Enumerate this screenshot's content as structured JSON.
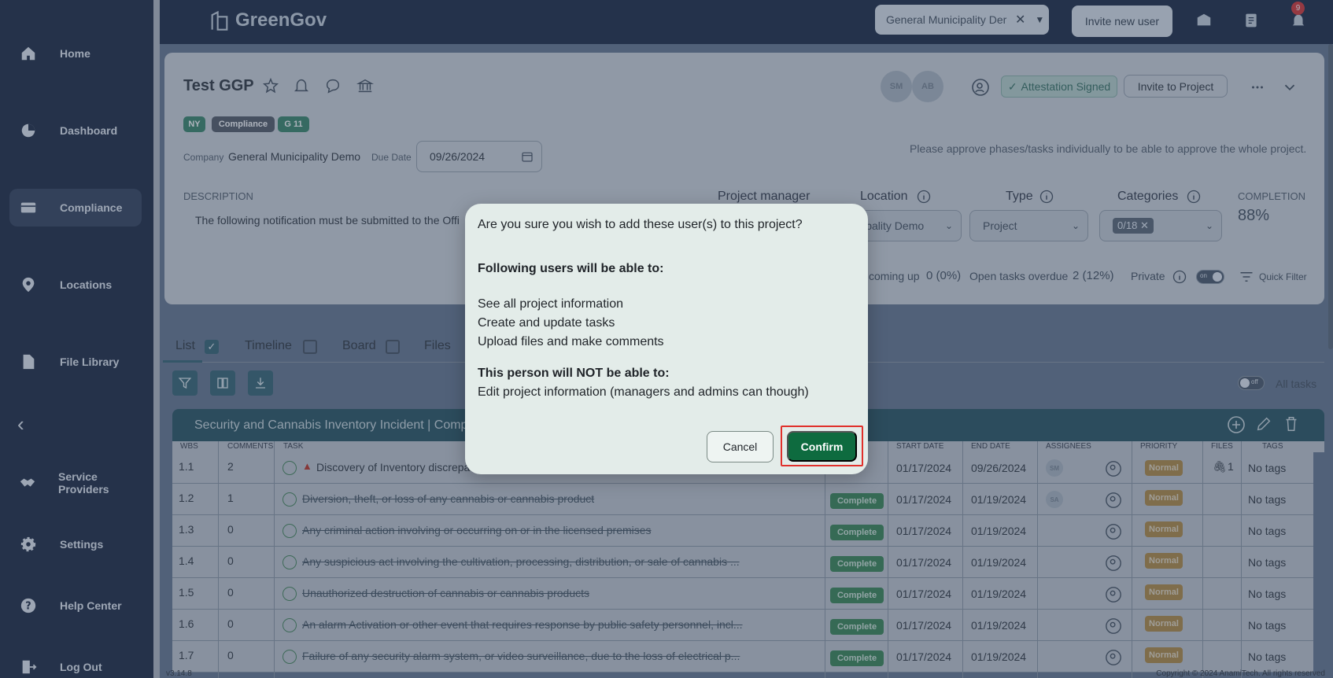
{
  "sidebar": {
    "items": [
      {
        "label": "Home",
        "icon": "home-icon"
      },
      {
        "label": "Dashboard",
        "icon": "pie-chart-icon"
      },
      {
        "label": "Compliance",
        "icon": "card-icon"
      },
      {
        "label": "Locations",
        "icon": "pin-icon"
      },
      {
        "label": "File Library",
        "icon": "file-icon"
      },
      {
        "label": "Service Providers",
        "icon": "handshake-icon"
      },
      {
        "label": "Settings",
        "icon": "gear-icon"
      },
      {
        "label": "Help Center",
        "icon": "help-icon"
      },
      {
        "label": "Log Out",
        "icon": "logout-icon"
      }
    ],
    "active": "Compliance",
    "collapse_glyph": "‹"
  },
  "topbar": {
    "logo": "GreenGov",
    "company_select": "General Municipality Der",
    "invite_new_user": "Invite new user",
    "notification_count": "9"
  },
  "project": {
    "title": "Test GGP",
    "tags": [
      {
        "label": "NY",
        "color": "#3f8a6e"
      },
      {
        "label": "Compliance",
        "color": "#59606b"
      },
      {
        "label": "G 11",
        "color": "#3f8a6e"
      }
    ],
    "company_label": "Company",
    "company_value": "General Municipality Demo",
    "due_date_label": "Due Date",
    "due_date_value": "09/26/2024",
    "avatars": [
      "SM",
      "AB"
    ],
    "attestation": "Attestation Signed",
    "invite_to_project": "Invite to Project",
    "approve_note": "Please approve phases/tasks individually to be able to approve the whole project.",
    "description_label": "DESCRIPTION",
    "description_text": "The following notification must be submitted to the Offi",
    "project_manager_label": "Project manager",
    "location_label": "Location",
    "location_value": "icipality Demo",
    "type_label": "Type",
    "type_value": "Project",
    "categories_label": "Categories",
    "categories_value": "0/18",
    "completion_label": "COMPLETION",
    "completion_value": "88%",
    "upcoming_label": "coming up",
    "upcoming_value": "0 (0%)",
    "overdue_label": "Open tasks overdue",
    "overdue_value": "2 (12%)",
    "private_label": "Private",
    "private_toggle": "on",
    "quick_filter": "Quick Filter"
  },
  "tabs": [
    {
      "label": "List",
      "checked": true
    },
    {
      "label": "Timeline",
      "checked": false
    },
    {
      "label": "Board",
      "checked": false
    },
    {
      "label": "Files"
    }
  ],
  "all_tasks": {
    "label": "All tasks",
    "toggle": "off"
  },
  "table": {
    "group_title": "Security and Cannabis Inventory Incident  | Comp",
    "columns": [
      "WBS",
      "COMMENTS",
      "TASK",
      "START DATE",
      "END DATE",
      "ASSIGNEES",
      "PRIORITY",
      "FILES",
      "TAGS"
    ],
    "rows": [
      {
        "wbs": "1.1",
        "comments": "2",
        "task": "Discovery of Inventory discrepa",
        "status": "",
        "start": "01/17/2024",
        "end": "09/26/2024",
        "assignee": "SM",
        "priority": "Normal",
        "files": "1",
        "tags": "No tags",
        "done": false
      },
      {
        "wbs": "1.2",
        "comments": "1",
        "task": "Diversion, theft, or loss of any cannabis or cannabis product",
        "status": "Complete",
        "start": "01/17/2024",
        "end": "01/19/2024",
        "assignee": "SA",
        "priority": "Normal",
        "files": "",
        "tags": "No tags",
        "done": true
      },
      {
        "wbs": "1.3",
        "comments": "0",
        "task": "Any criminal action involving or occurring on or in the licensed premises",
        "status": "Complete",
        "start": "01/17/2024",
        "end": "01/19/2024",
        "assignee": "",
        "priority": "Normal",
        "files": "",
        "tags": "No tags",
        "done": true
      },
      {
        "wbs": "1.4",
        "comments": "0",
        "task": "Any suspicious act involving the cultivation, processing, distribution, or sale of cannabis ...",
        "status": "Complete",
        "start": "01/17/2024",
        "end": "01/19/2024",
        "assignee": "",
        "priority": "Normal",
        "files": "",
        "tags": "No tags",
        "done": true
      },
      {
        "wbs": "1.5",
        "comments": "0",
        "task": "Unauthorized destruction of cannabis or cannabis products",
        "status": "Complete",
        "start": "01/17/2024",
        "end": "01/19/2024",
        "assignee": "",
        "priority": "Normal",
        "files": "",
        "tags": "No tags",
        "done": true
      },
      {
        "wbs": "1.6",
        "comments": "0",
        "task": "An alarm Activation or other event that requires response by public safety personnel, incl...",
        "status": "Complete",
        "start": "01/17/2024",
        "end": "01/19/2024",
        "assignee": "",
        "priority": "Normal",
        "files": "",
        "tags": "No tags",
        "done": true
      },
      {
        "wbs": "1.7",
        "comments": "0",
        "task": "Failure of any security alarm system, or video surveillance, due to the loss of electrical p...",
        "status": "Complete",
        "start": "01/17/2024",
        "end": "01/19/2024",
        "assignee": "",
        "priority": "Normal",
        "files": "",
        "tags": "No tags",
        "done": true
      }
    ]
  },
  "footer": {
    "version": "v3.14.8",
    "copyright": "Copyright © 2024 AnamiTech. All rights reserved"
  },
  "modal": {
    "question": "Are you sure you wish to add these user(s) to this project?",
    "can_heading": "Following users will be able to:",
    "can_items": [
      "See all project information",
      "Create and update tasks",
      "Upload files and make comments"
    ],
    "cannot_heading": "This person will NOT be able to:",
    "cannot_items": [
      "Edit project information (managers and admins can though)"
    ],
    "cancel": "Cancel",
    "confirm": "Confirm"
  }
}
